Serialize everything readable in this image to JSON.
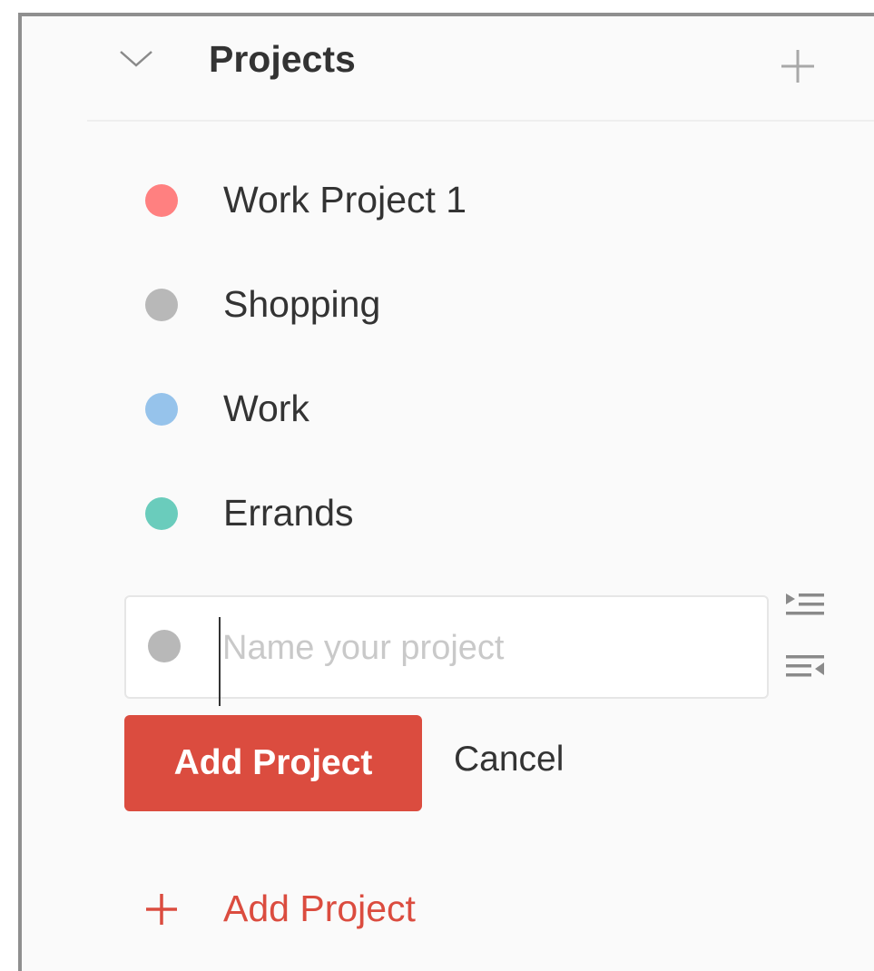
{
  "section": {
    "title": "Projects"
  },
  "projects": [
    {
      "label": "Work Project 1",
      "color": "#ff8080"
    },
    {
      "label": "Shopping",
      "color": "#b8b8b8"
    },
    {
      "label": "Work",
      "color": "#96c3eb"
    },
    {
      "label": "Errands",
      "color": "#6accbc"
    }
  ],
  "editor": {
    "placeholder": "Name your project",
    "value": "",
    "dot_color": "#b8b8b8"
  },
  "actions": {
    "submit_label": "Add Project",
    "cancel_label": "Cancel",
    "primary_color": "#db4c3f"
  },
  "footer": {
    "add_label": "Add Project"
  },
  "icons": {
    "collapse": "chevron-down-icon",
    "add": "plus-icon",
    "indent": "indent-icon",
    "outdent": "outdent-icon"
  }
}
